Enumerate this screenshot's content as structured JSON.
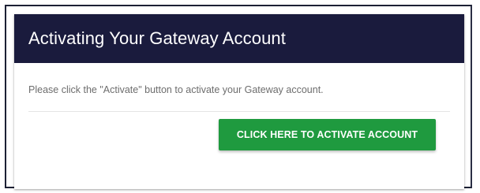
{
  "card": {
    "title": "Activating Your Gateway Account",
    "message": "Please click the \"Activate\" button to activate your Gateway account.",
    "activate_button_label": "CLICK HERE TO ACTIVATE ACCOUNT"
  },
  "colors": {
    "header_background": "#1a1b3d",
    "button_background": "#1f9a3f",
    "message_text": "#6d6d6d"
  }
}
